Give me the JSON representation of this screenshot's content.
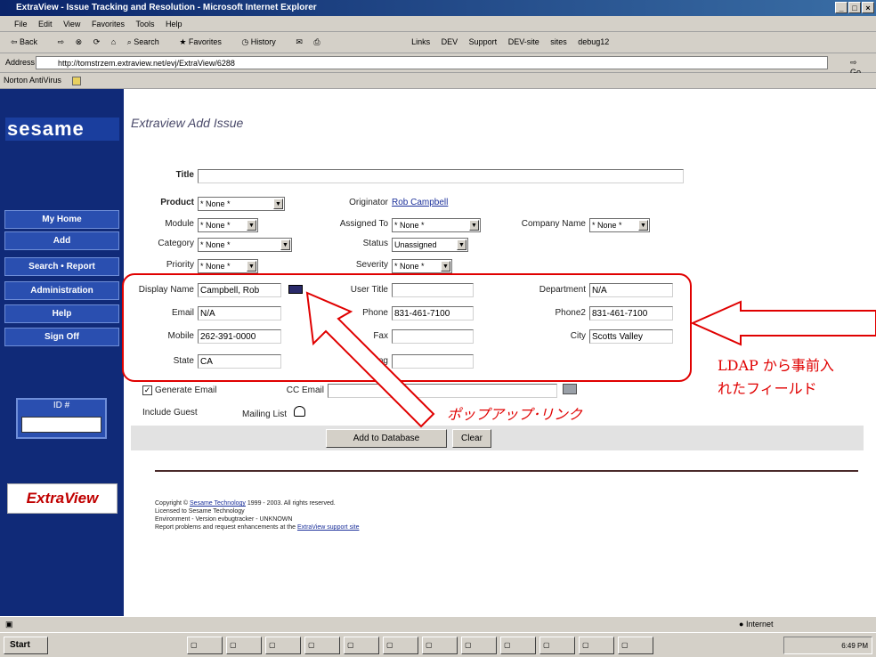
{
  "window": {
    "title": "ExtraView - Issue Tracking and Resolution - Microsoft Internet Explorer"
  },
  "menu": [
    "File",
    "Edit",
    "View",
    "Favorites",
    "Tools",
    "Help"
  ],
  "toolbar": {
    "back": "Back",
    "search": "Search",
    "favorites": "Favorites",
    "history": "History",
    "links": "Links",
    "link_items": [
      "DEV",
      "Support",
      "DEV-site",
      "sites",
      "debug12"
    ]
  },
  "address": {
    "label": "Address",
    "url": "http://tomstrzem.extraview.net/evj/ExtraView/6288",
    "go": "Go"
  },
  "norton": {
    "label": "Norton AntiVirus"
  },
  "nav": {
    "logo": "sesame",
    "items": [
      "My Home",
      "Add",
      "Search • Report",
      "Administration",
      "Help",
      "Sign Off"
    ],
    "id_label": "ID #",
    "extraview_logo": "ExtraView"
  },
  "page": {
    "title": "Extraview Add Issue"
  },
  "form": {
    "title_label": "Title",
    "product_label": "Product",
    "product_value": "* None *",
    "originator_label": "Originator",
    "originator_value": "Rob Campbell",
    "module_label": "Module",
    "module_value": "* None *",
    "assigned_label": "Assigned To",
    "assigned_value": "* None *",
    "company_label": "Company Name",
    "company_value": "* None *",
    "category_label": "Category",
    "category_value": "* None *",
    "status_label": "Status",
    "status_value": "Unassigned",
    "priority_label": "Priority",
    "priority_value": "* None *",
    "severity_label": "Severity",
    "severity_value": "* None *",
    "display_name_label": "Display Name",
    "display_name_value": "Campbell, Rob",
    "user_title_label": "User Title",
    "user_title_value": "",
    "department_label": "Department",
    "department_value": "N/A",
    "email_label": "Email",
    "email_value": "N/A",
    "phone_label": "Phone",
    "phone_value": "831-461-7100",
    "phone2_label": "Phone2",
    "phone2_value": "831-461-7100",
    "mobile_label": "Mobile",
    "mobile_value": "262-391-0000",
    "fax_label": "Fax",
    "fax_value": "",
    "city_label": "City",
    "city_value": "Scotts Valley",
    "state_label": "State",
    "state_value": "CA",
    "building_label": "Building",
    "building_value": "",
    "generate_email_label": "Generate Email",
    "cc_email_label": "CC Email",
    "include_guest_label": "Include Guest",
    "mailing_list_label": "Mailing List",
    "add_button": "Add to Database",
    "clear_button": "Clear"
  },
  "footer": {
    "line1_prefix": "Copyright ©",
    "line1_link": "Sesame Technology",
    "line1_suffix": "1999 - 2003.  All rights reserved.",
    "line2": "Licensed to Sesame Technology",
    "line3": "Environment - Version evbugtracker - UNKNOWN",
    "line4_prefix": "Report problems and request enhancements at the",
    "line4_link": "ExtraView support site"
  },
  "annotations": {
    "ldap_line1": "LDAP から事前入",
    "ldap_line2": "れたフィールド",
    "popup_link": "ポップアップ･リンク"
  },
  "status": {
    "zone": "Internet"
  },
  "taskbar": {
    "start": "Start",
    "clock": "6:49 PM"
  },
  "colors": {
    "nav_bg": "#102a78",
    "annotation": "#e00000"
  }
}
